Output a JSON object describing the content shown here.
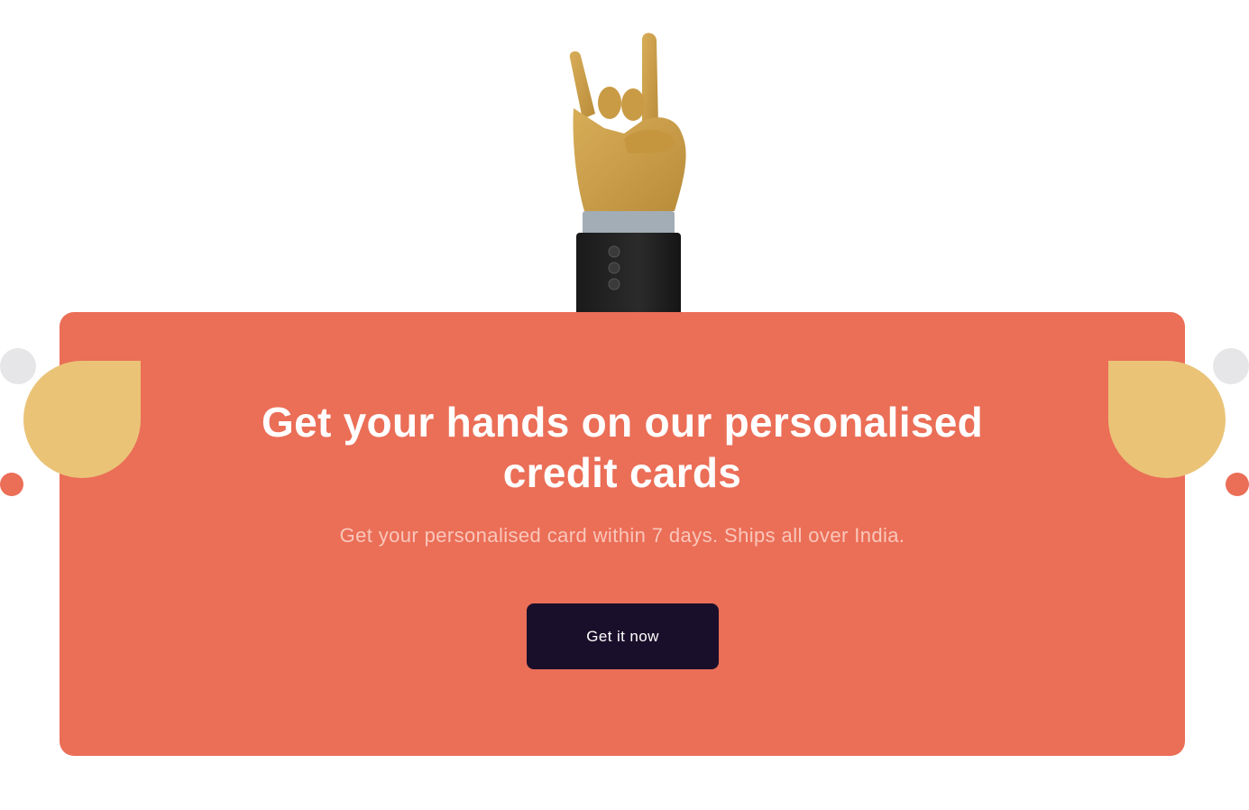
{
  "cta": {
    "title_line_1": "Get your hands on our personalised",
    "title_line_2": "credit cards",
    "subtitle": "Get your personalised card within 7 days. Ships all over India.",
    "button_label": "Get it now"
  },
  "colors": {
    "card_background": "#eb6e57",
    "button_background": "#1a0f2a",
    "accent_yellow": "#eac377",
    "decor_grey": "#e6e6e8",
    "title_text": "#ffffff",
    "subtitle_text": "#f9c7bb"
  },
  "illustration": {
    "icon": "rock-on-hand-gesture-icon"
  }
}
